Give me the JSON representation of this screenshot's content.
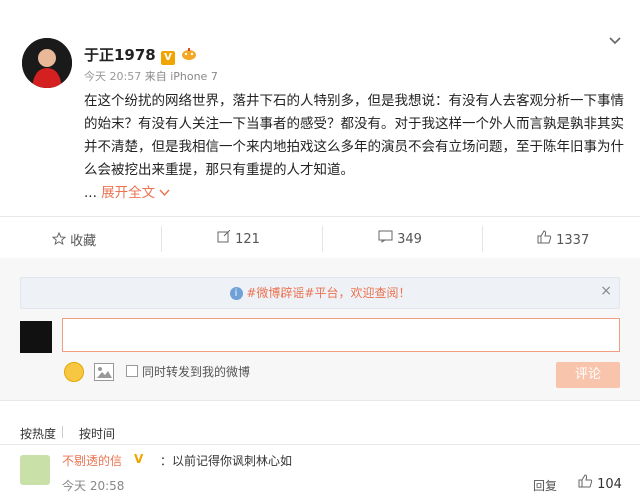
{
  "post": {
    "username": "于正1978",
    "verified_badge": "V",
    "badge_icon": "sprout-badge-icon",
    "time": "今天 20:57",
    "source": "来自 iPhone 7",
    "body": "在这个纷扰的网络世界，落井下石的人特别多，但是我想说：有没有人去客观分析一下事情的始末？有没有人关注一下当事者的感受？都没有。对于我这样一个外人而言孰是孰非其实并不清楚，但是我相信一个来内地拍戏这么多年的演员不会有立场问题，至于陈年旧事为什么会被挖出来重提，那只有重提的人才知道。",
    "ellipsis": "...",
    "expand_label": "展开全文"
  },
  "actions": {
    "favorite": "收藏",
    "repost_count": "121",
    "comment_count": "349",
    "like_count": "1337"
  },
  "notice": {
    "prefix": "",
    "link": "#微博辟谣#平台",
    "suffix": "，欢迎查阅！"
  },
  "composer": {
    "repost_label": "同时转发到我的微博",
    "submit_label": "评论"
  },
  "sort": {
    "by_hot": "按热度",
    "by_time": "按时间"
  },
  "comment": {
    "name": "不剔透的信",
    "badge": "V",
    "text": "：以前记得你讽刺林心如",
    "time": "今天 20:58",
    "reply_label": "回复",
    "like_count": "104"
  },
  "colors": {
    "accent": "#eb7350",
    "verified": "#f0a500"
  }
}
